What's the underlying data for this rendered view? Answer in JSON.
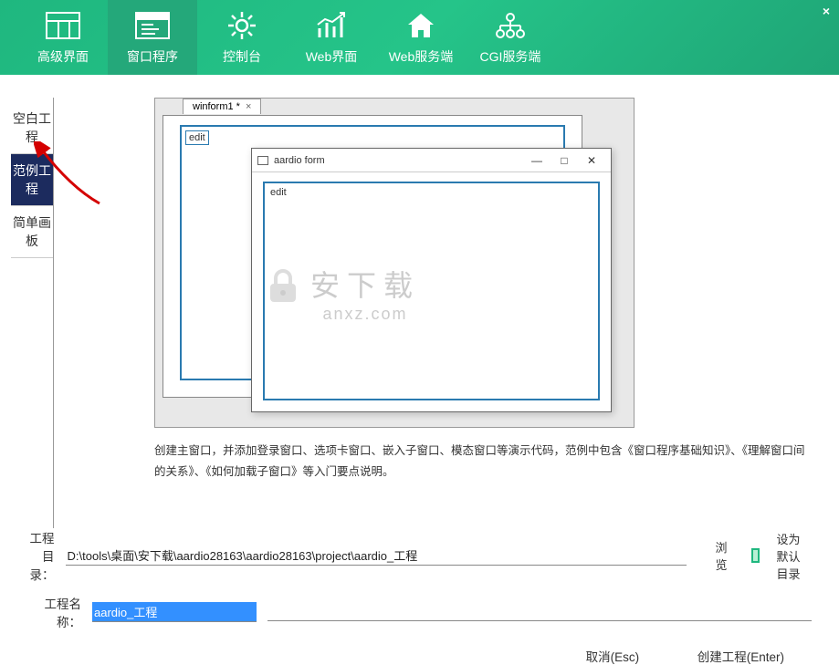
{
  "header": {
    "nav": [
      {
        "label": "高级界面",
        "icon": "layout"
      },
      {
        "label": "窗口程序",
        "icon": "window",
        "active": true
      },
      {
        "label": "控制台",
        "icon": "gear"
      },
      {
        "label": "Web界面",
        "icon": "chart"
      },
      {
        "label": "Web服务端",
        "icon": "home"
      },
      {
        "label": "CGI服务端",
        "icon": "network"
      }
    ],
    "close": "×"
  },
  "sidebar": {
    "items": [
      {
        "label": "空白工程"
      },
      {
        "label": "范例工程",
        "selected": true
      },
      {
        "label": "简单画板"
      }
    ]
  },
  "preview": {
    "tab_label": "winform1 *",
    "back_edit": "edit",
    "front_title": "aardio form",
    "front_edit": "edit",
    "titlebar_min": "—",
    "titlebar_max": "□",
    "titlebar_close": "✕"
  },
  "watermark": {
    "main": "安下载",
    "sub": "anxz.com"
  },
  "description": "创建主窗口，并添加登录窗口、选项卡窗口、嵌入子窗口、模态窗口等演示代码，范例中包含《窗口程序基础知识》、《理解窗口间的关系》、《如何加载子窗口》等入门要点说明。",
  "fields": {
    "dir_label": "工程目录：",
    "dir_value": "D:\\tools\\桌面\\安下载\\aardio28163\\aardio28163\\project\\aardio_工程",
    "name_label": "工程名称：",
    "name_value": "aardio_工程",
    "browse": "浏览",
    "default_dir": "设为默认目录"
  },
  "actions": {
    "cancel": "取消(Esc)",
    "create": "创建工程(Enter)"
  }
}
